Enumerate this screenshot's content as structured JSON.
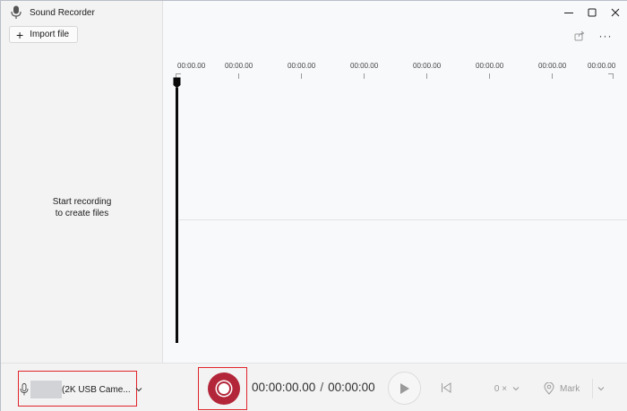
{
  "app": {
    "title": "Sound Recorder"
  },
  "sidebar": {
    "import_label": "Import file",
    "empty_line1": "Start recording",
    "empty_line2": "to create files"
  },
  "window_controls": {
    "minimize": "—",
    "maximize": "☐",
    "close": "✕"
  },
  "toolbar": {
    "more": "···"
  },
  "timeline": {
    "labels": [
      "00:00.00",
      "00:00.00",
      "00:00.00",
      "00:00.00",
      "00:00.00",
      "00:00.00",
      "00:00.00",
      "00:00.00"
    ]
  },
  "bottom": {
    "microphone_label": "(2K USB Came...",
    "current_time": "00:00:00.00",
    "separator": "/",
    "total_time": "00:00:00",
    "speed": "0 ×",
    "mark_label": "Mark"
  },
  "colors": {
    "record": "#b3263a",
    "highlight_box": "#e0242b"
  }
}
